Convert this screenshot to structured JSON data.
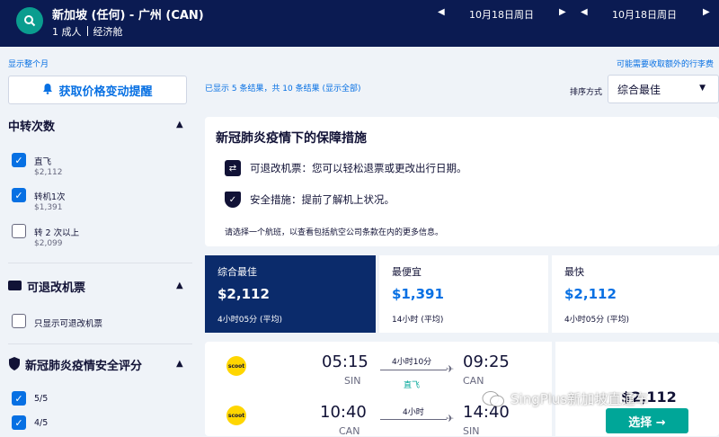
{
  "header": {
    "route": "新加坡 (任何) - 广州 (CAN)",
    "passengers": "1 成人",
    "cabin": "经济舱",
    "depart_date": "10月18日周日",
    "return_date": "10月18日周日"
  },
  "links": {
    "show_month": "显示整个月",
    "baggage_fee": "可能需要收取额外的行李费"
  },
  "price_alert": "获取价格变动提醒",
  "filters": {
    "stops": {
      "title": "中转次数",
      "options": [
        {
          "label": "直飞",
          "price": "$2,112",
          "checked": true
        },
        {
          "label": "转机1次",
          "price": "$1,391",
          "checked": true
        },
        {
          "label": "转 2 次以上",
          "price": "$2,099",
          "checked": false
        }
      ]
    },
    "refundable": {
      "title": "可退改机票",
      "option": "只显示可退改机票"
    },
    "covid_rating": {
      "title": "新冠肺炎疫情安全评分",
      "options": [
        {
          "label": "5/5",
          "checked": true
        },
        {
          "label": "4/5",
          "checked": true
        }
      ]
    }
  },
  "results": {
    "info": "已显示 5 条结果，共 10 条结果 (显示全部)",
    "sort_label": "排序方式",
    "sort_value": "综合最佳"
  },
  "covid": {
    "title": "新冠肺炎疫情下的保障措施",
    "refund": "可退改机票：您可以轻松退票或更改出行日期。",
    "safety": "安全措施：提前了解机上状况。",
    "note": "请选择一个航班，以查看包括航空公司条款在内的更多信息。"
  },
  "tabs": [
    {
      "label": "综合最佳",
      "price": "$2,112",
      "duration": "4小时05分 (平均)"
    },
    {
      "label": "最便宜",
      "price": "$1,391",
      "duration": "14小时 (平均)"
    },
    {
      "label": "最快",
      "price": "$2,112",
      "duration": "4小时05分 (平均)"
    }
  ],
  "flights": [
    {
      "airline": "scoot",
      "dep_time": "05:15",
      "dep_code": "SIN",
      "duration": "4小时10分",
      "stops": "直飞",
      "arr_time": "09:25",
      "arr_code": "CAN"
    },
    {
      "airline": "scoot",
      "dep_time": "10:40",
      "dep_code": "CAN",
      "duration": "4小时",
      "stops": "",
      "arr_time": "14:40",
      "arr_code": "SIN"
    }
  ],
  "offer": {
    "price": "$2,112",
    "select": "选择 →"
  },
  "watermark": "SingPlus新加坡直通车",
  "colors": {
    "header_bg": "#0b1b52",
    "accent_blue": "#0770e3",
    "teal": "#00a698",
    "active_tab": "#0b2b6b",
    "scoot_yellow": "#ffd600"
  }
}
